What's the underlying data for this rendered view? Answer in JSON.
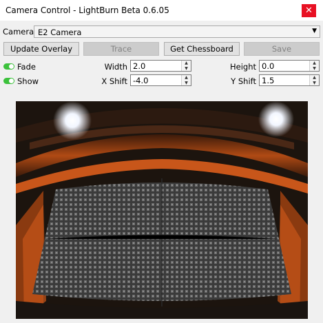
{
  "window": {
    "title": "Camera Control - LightBurn Beta 0.6.05",
    "close_glyph": "✕"
  },
  "camera": {
    "label": "Camera:",
    "selected": "E2 Camera"
  },
  "buttons": {
    "update_overlay": "Update Overlay",
    "trace": "Trace",
    "get_chessboard": "Get Chessboard",
    "save": "Save"
  },
  "toggles": {
    "fade": {
      "label": "Fade",
      "on": true
    },
    "show": {
      "label": "Show",
      "on": true
    }
  },
  "fields": {
    "width": {
      "label": "Width",
      "value": "2.0"
    },
    "height": {
      "label": "Height",
      "value": "0.0"
    },
    "x_shift": {
      "label": "X Shift",
      "value": "-4.0"
    },
    "y_shift": {
      "label": "Y Shift",
      "value": "1.5"
    }
  },
  "icons": {
    "dropdown": "chevron-down-icon",
    "spin_up": "arrow-up-icon",
    "spin_down": "arrow-down-icon",
    "close": "close-icon"
  },
  "colors": {
    "toggle_on": "#3cc13c",
    "close_button": "#e81123"
  }
}
